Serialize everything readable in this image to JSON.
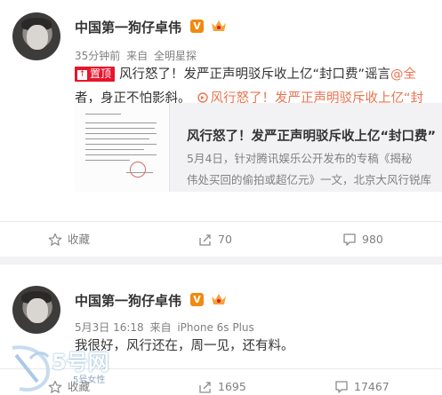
{
  "posts": [
    {
      "username": "中国第一狗仔卓伟",
      "verified_badge": "V",
      "meta": {
        "time": "35分钟前",
        "source_prefix": "来自",
        "source": "全明星探"
      },
      "pin_label": "置顶",
      "text_line1": "风行怒了！发严正声明驳斥收上亿“封口费”谣言",
      "mention": "@全",
      "text_line2": "者，身正不怕影斜。",
      "link_text": "风行怒了！发严正声明驳斥收上亿“封",
      "preview": {
        "title": "风行怒了！发严正声明驳斥收上亿“封口费”",
        "desc_line1": "5月4日，针对腾讯娱乐公开发布的专稿《揭秘",
        "desc_line2": "伟处买回的偷拍或超亿元》一文，北京大风行锐库"
      },
      "actions": {
        "favorite": "收藏",
        "forward": "70",
        "comment": "980"
      }
    },
    {
      "username": "中国第一狗仔卓伟",
      "verified_badge": "V",
      "meta": {
        "time": "5月3日 16:18",
        "source_prefix": "来自",
        "source": "iPhone 6s Plus"
      },
      "text": "我很好，风行还在，周一见，还有料。",
      "actions": {
        "favorite": "收藏",
        "forward": "1695",
        "comment": "17467"
      }
    }
  ],
  "watermark": {
    "site": "5号网",
    "sub": "5号女性"
  },
  "colors": {
    "accent": "#eb7350",
    "pin": "#e6162d",
    "badge": "#f08a11"
  }
}
